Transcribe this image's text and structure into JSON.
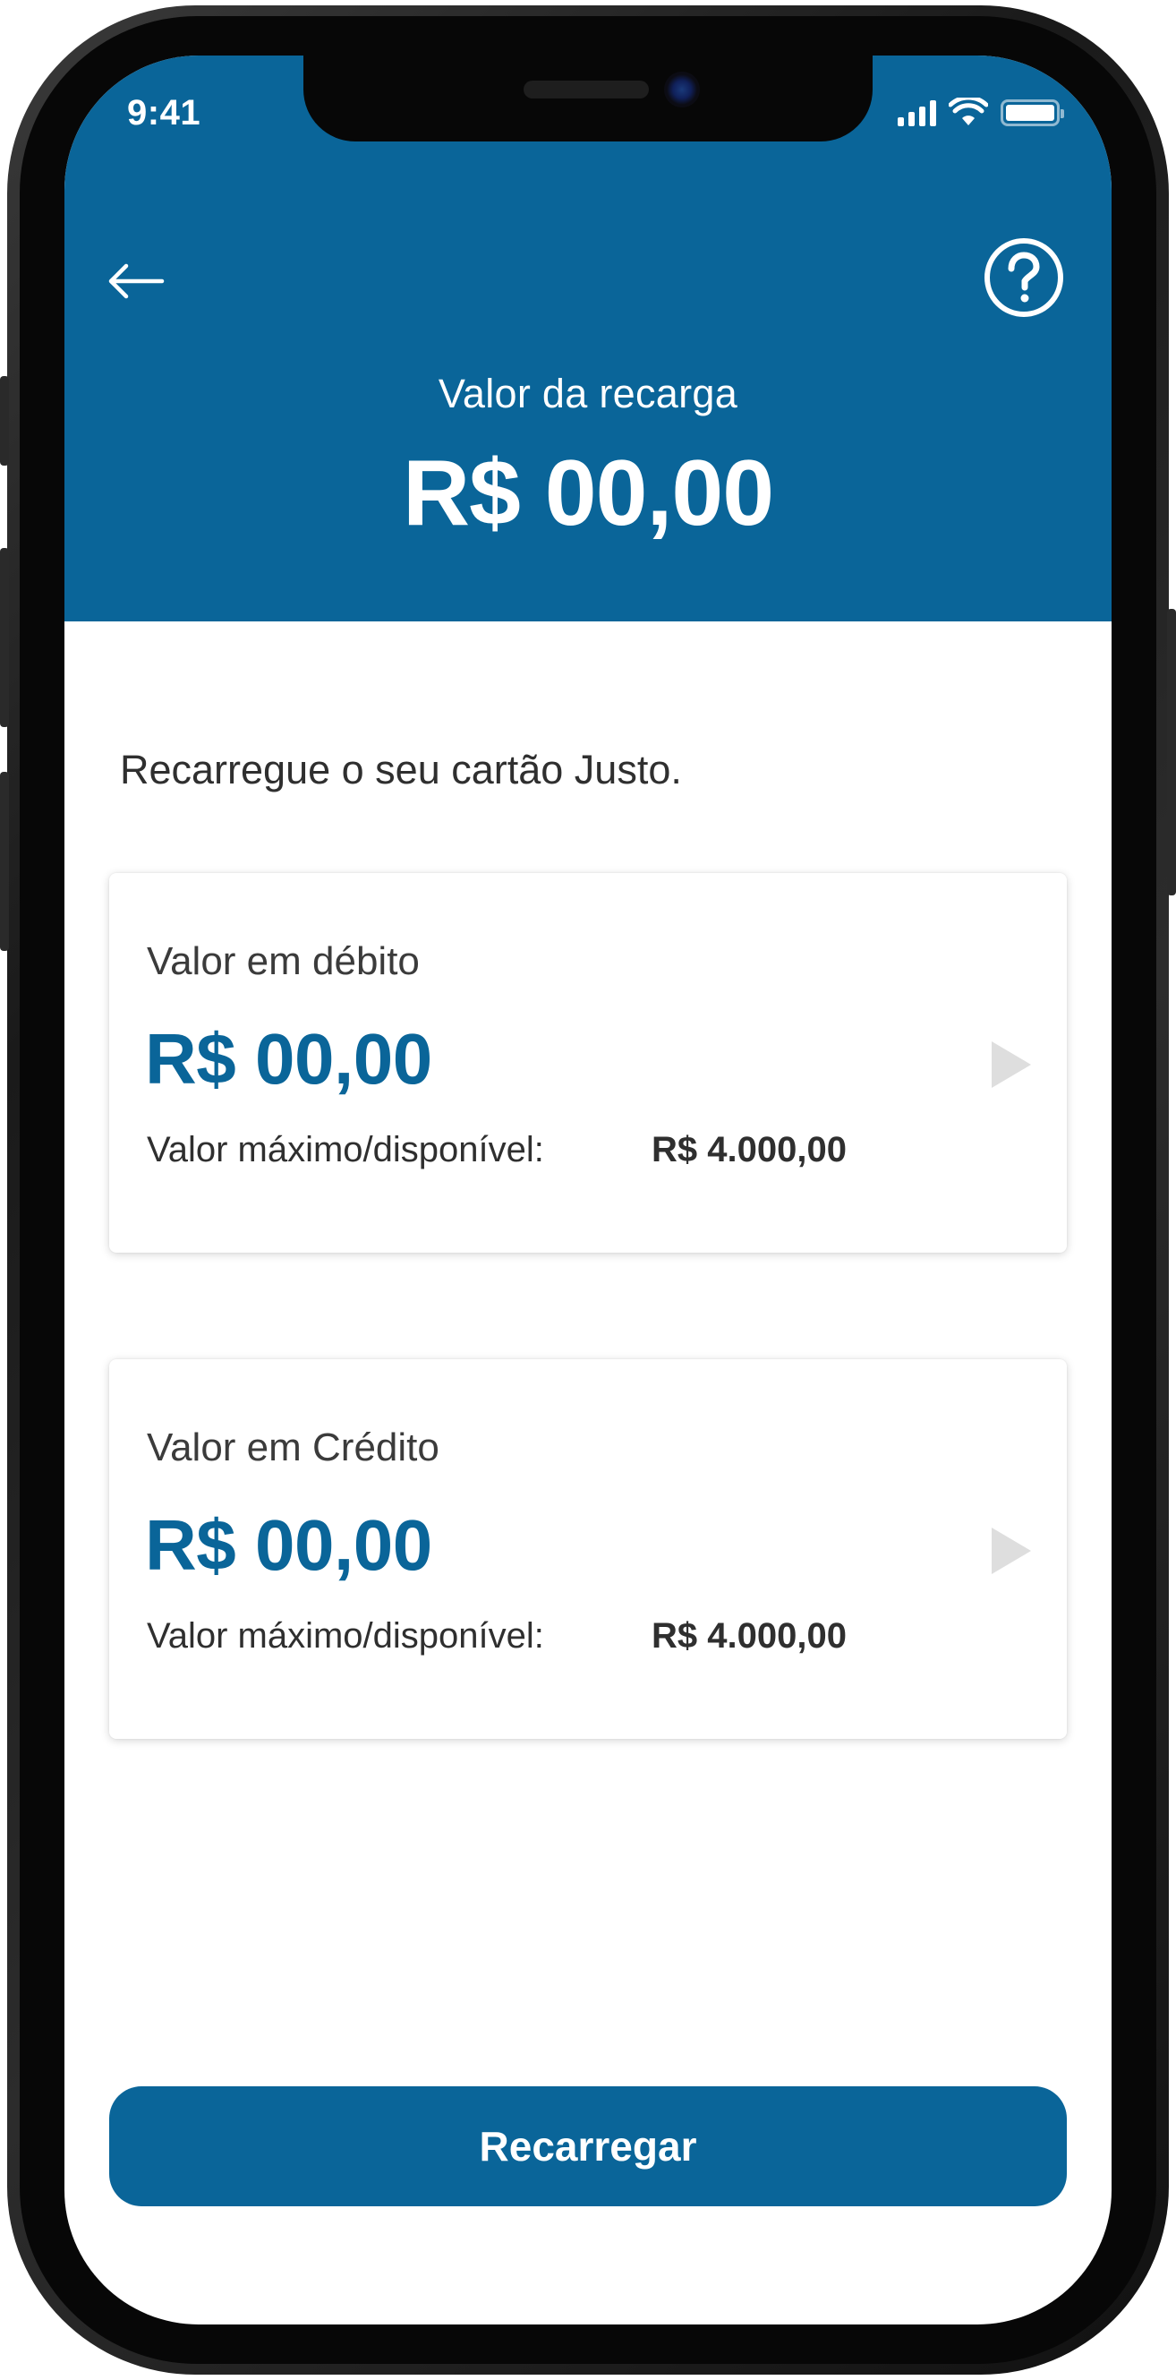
{
  "status_bar": {
    "time": "9:41"
  },
  "header": {
    "label": "Valor da recarga",
    "amount": "R$ 00,00",
    "background_color": "#0a6599",
    "back_icon": "arrow-left-icon",
    "help_icon": "question-circle-icon"
  },
  "intro_text": "Recarregue o seu cartão Justo.",
  "cards": [
    {
      "label": "Valor em débito",
      "amount": "R$ 00,00",
      "max_label": "Valor máximo/disponível:",
      "max_value": "R$ 4.000,00",
      "arrow_icon": "play-arrow-icon"
    },
    {
      "label": "Valor em Crédito",
      "amount": "R$ 00,00",
      "max_label": "Valor máximo/disponível:",
      "max_value": "R$ 4.000,00",
      "arrow_icon": "play-arrow-icon"
    }
  ],
  "primary_button": {
    "label": "Recarregar",
    "color": "#0a6599"
  }
}
